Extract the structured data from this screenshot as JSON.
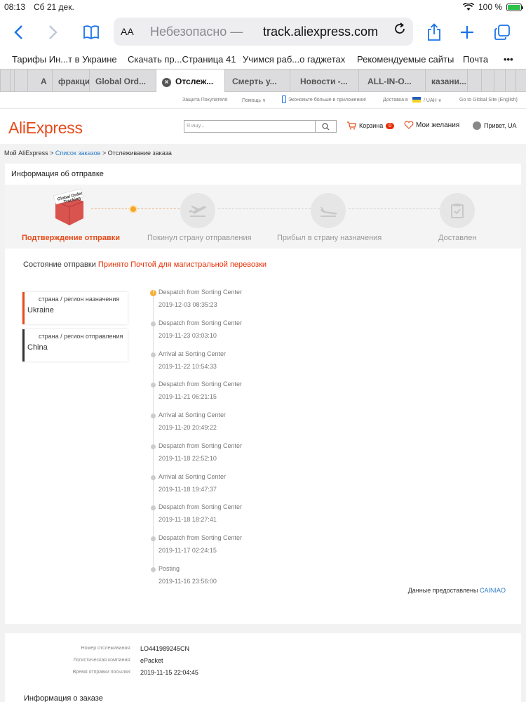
{
  "status_bar": {
    "time": "08:13",
    "date": "Сб 21 дек.",
    "battery": "100 %"
  },
  "browser": {
    "aa": "AA",
    "insecure": "Небезопасно —",
    "domain": "track.aliexpress.com",
    "bookmarks": [
      "Тарифы Ин...т в Украине",
      "Скачать пр...Страница 41",
      "Учимся раб...о гаджетах",
      "Рекомендуемые сайты",
      "Почта",
      "•••"
    ],
    "tabs": [
      "A",
      "фракци",
      "Global Ord...",
      "Отслеж...",
      "Смерть у...",
      "Новости -...",
      "ALL-IN-O...",
      "казани..."
    ]
  },
  "ae": {
    "util": [
      "Защита Покупателя",
      "Помощь ∨",
      "Экономьте больше в приложении!",
      "Доставка в",
      "/ UAH ∨",
      "Go to Global Site (English)"
    ],
    "logo": "AliExpress",
    "search_placeholder": "Я ищу...",
    "cart": "Корзина",
    "cart_count": "0",
    "wishlist": "Мои желания",
    "hello": "Привет, UA"
  },
  "breadcrumb": {
    "home": "Мой AliExpress >",
    "orders": "Список заказов",
    "current": "> Отслеживание заказа"
  },
  "shipment": {
    "title": "Информация об отправке",
    "badge_text": "Global Order Tracking",
    "steps": [
      "Подтверждение отправки",
      "Покинул страну отправления",
      "Прибыл в страну назначения",
      "Доставлен"
    ],
    "status_label": "Состояние отправки",
    "status_value": "Принято Почтой для магистральной перевозки",
    "destination_label": "страна / регион назначения",
    "destination": "Ukraine",
    "origin_label": "страна / регион отправления",
    "origin": "China",
    "events": [
      {
        "desc": "Despatch from Sorting Center",
        "ts": "2019-12-03 08:35:23"
      },
      {
        "desc": "Despatch from Sorting Center",
        "ts": "2019-11-23 03:03:10"
      },
      {
        "desc": "Arrival at Sorting Center",
        "ts": "2019-11-22 10:54:33"
      },
      {
        "desc": "Despatch from Sorting Center",
        "ts": "2019-11-21 06:21:15"
      },
      {
        "desc": "Arrival at Sorting Center",
        "ts": "2019-11-20 20:49:22"
      },
      {
        "desc": "Despatch from Sorting Center",
        "ts": "2019-11-18 22:52:10"
      },
      {
        "desc": "Arrival at Sorting Center",
        "ts": "2019-11-18 19:47:37"
      },
      {
        "desc": "Despatch from Sorting Center",
        "ts": "2019-11-18 18:27:41"
      },
      {
        "desc": "Despatch from Sorting Center",
        "ts": "2019-11-17 02:24:15"
      },
      {
        "desc": "Posting",
        "ts": "2019-11-16 23:56:00"
      }
    ],
    "provider_label": "Данные предоставлены",
    "provider": "CAINIAO"
  },
  "info": {
    "tracking_label": "Номер отслеживания:",
    "tracking": "LO441989245CN",
    "company_label": "Логистическая компания:",
    "company": "ePacket",
    "sent_label": "Время отправки посылки:",
    "sent": "2019-11-15 22:04:45",
    "order_info": "Информация о заказе"
  },
  "colors": {
    "brand": "#e64a19",
    "link": "#2a7ac8",
    "alert": "#e62e04",
    "accent": "#f5a623"
  }
}
